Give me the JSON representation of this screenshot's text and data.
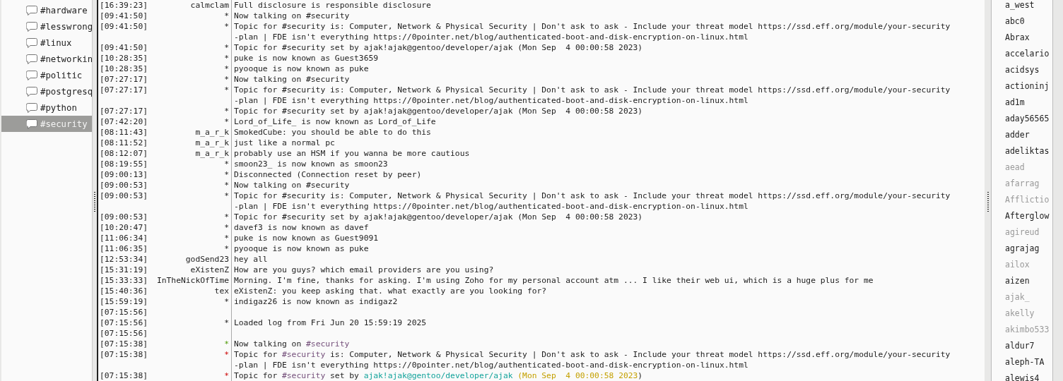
{
  "channels": [
    {
      "label": "#hardware",
      "selected": false
    },
    {
      "label": "#lesswrong",
      "selected": false
    },
    {
      "label": "#linux",
      "selected": false
    },
    {
      "label": "#networkin",
      "selected": false
    },
    {
      "label": "#politic",
      "selected": false
    },
    {
      "label": "#postgresq",
      "selected": false
    },
    {
      "label": "#python",
      "selected": false
    },
    {
      "label": "#security",
      "selected": true
    }
  ],
  "log": [
    {
      "time": "[16:39:23]",
      "nick": "calmclam",
      "text": "Full disclosure is responsible disclosure"
    },
    {
      "time": "[09:41:50]",
      "nick": "*",
      "text": "Now talking on #security"
    },
    {
      "time": "[09:41:50]",
      "nick": "*",
      "lines": [
        "Topic for #security is: Computer, Network & Physical Security | Don't ask to ask - Include your threat model https://ssd.eff.org/module/your-security",
        "-plan | FDE isn't everything https://0pointer.net/blog/authenticated-boot-and-disk-encryption-on-linux.html"
      ]
    },
    {
      "time": "[09:41:50]",
      "nick": "*",
      "text": "Topic for #security set by ajak!ajak@gentoo/developer/ajak (Mon Sep  4 00:00:58 2023)"
    },
    {
      "time": "[10:28:35]",
      "nick": "*",
      "text": "puke is now known as Guest3659"
    },
    {
      "time": "[10:28:35]",
      "nick": "*",
      "text": "pyooque is now known as puke"
    },
    {
      "time": "[07:27:17]",
      "nick": "*",
      "text": "Now talking on #security"
    },
    {
      "time": "[07:27:17]",
      "nick": "*",
      "lines": [
        "Topic for #security is: Computer, Network & Physical Security | Don't ask to ask - Include your threat model https://ssd.eff.org/module/your-security",
        "-plan | FDE isn't everything https://0pointer.net/blog/authenticated-boot-and-disk-encryption-on-linux.html"
      ]
    },
    {
      "time": "[07:27:17]",
      "nick": "*",
      "text": "Topic for #security set by ajak!ajak@gentoo/developer/ajak (Mon Sep  4 00:00:58 2023)"
    },
    {
      "time": "[07:42:20]",
      "nick": "*",
      "text": "Lord_of_Life_ is now known as Lord_of_Life"
    },
    {
      "time": "[08:11:43]",
      "nick": "m_a_r_k",
      "text": "SmokedCube: you should be able to do this"
    },
    {
      "time": "[08:11:52]",
      "nick": "m_a_r_k",
      "text": "just like a normal pc"
    },
    {
      "time": "[08:12:07]",
      "nick": "m_a_r_k",
      "text": "probably use an HSM if you wanna be more cautious"
    },
    {
      "time": "[08:19:55]",
      "nick": "*",
      "text": "smoon23_ is now known as smoon23"
    },
    {
      "time": "[09:00:13]",
      "nick": "*",
      "text": "Disconnected (Connection reset by peer)"
    },
    {
      "time": "[09:00:53]",
      "nick": "*",
      "text": "Now talking on #security"
    },
    {
      "time": "[09:00:53]",
      "nick": "*",
      "lines": [
        "Topic for #security is: Computer, Network & Physical Security | Don't ask to ask - Include your threat model https://ssd.eff.org/module/your-security",
        "-plan | FDE isn't everything https://0pointer.net/blog/authenticated-boot-and-disk-encryption-on-linux.html"
      ]
    },
    {
      "time": "[09:00:53]",
      "nick": "*",
      "text": "Topic for #security set by ajak!ajak@gentoo/developer/ajak (Mon Sep  4 00:00:58 2023)"
    },
    {
      "time": "[10:20:47]",
      "nick": "*",
      "text": "davef3 is now known as davef"
    },
    {
      "time": "[11:06:34]",
      "nick": "*",
      "text": "puke is now known as Guest9091"
    },
    {
      "time": "[11:06:35]",
      "nick": "*",
      "text": "pyooque is now known as puke"
    },
    {
      "time": "[12:53:34]",
      "nick": "godSend23",
      "text": "hey all"
    },
    {
      "time": "[15:31:19]",
      "nick": "eXistenZ",
      "text": "How are you guys? which email providers are you using?"
    },
    {
      "time": "[15:33:33]",
      "nick": "InTheNickOfTime",
      "text": "Morning. I'm fine, thanks for asking. I'm using Zoho for my personal account atm ... I like their web ui, which is a huge plus for me"
    },
    {
      "time": "[15:40:36]",
      "nick": "tex",
      "text": "eXistenZ: you keep asking that. what exactly are you looking for?"
    },
    {
      "time": "[15:59:19]",
      "nick": "*",
      "text": "indigaz26 is now known as indigaz2"
    },
    {
      "time": "[07:15:56]"
    },
    {
      "time": "[07:15:56]",
      "nick": "*",
      "text": "Loaded log from Fri Jun 20 15:59:19 2025"
    },
    {
      "time": "[07:15:56]"
    },
    {
      "time": "[07:15:38]",
      "nick": {
        "text": "*",
        "kind": "join"
      },
      "segments": [
        [
          {
            "text": "Now talking on ",
            "kind": "plain"
          },
          {
            "text": "#security",
            "kind": "channel"
          }
        ]
      ]
    },
    {
      "time": "[07:15:38]",
      "nick": {
        "text": "*",
        "kind": "topic"
      },
      "segments": [
        [
          {
            "text": "Topic for ",
            "kind": "plain"
          },
          {
            "text": "#security",
            "kind": "channel"
          },
          {
            "text": " is: Computer, Network & Physical Security | Don't ask to ask - Include your threat model https://ssd.eff.org/module/your-security",
            "kind": "plain"
          }
        ],
        [
          {
            "text": "-plan | FDE isn't everything https://0pointer.net/blog/authenticated-boot-and-disk-encryption-on-linux.html",
            "kind": "plain"
          }
        ]
      ]
    },
    {
      "time": "[07:15:38]",
      "nick": {
        "text": "*",
        "kind": "topic"
      },
      "segments": [
        [
          {
            "text": "Topic for ",
            "kind": "plain"
          },
          {
            "text": "#security",
            "kind": "channel"
          },
          {
            "text": " set by ",
            "kind": "plain"
          },
          {
            "text": "ajak!ajak@gentoo/developer/ajak",
            "kind": "host"
          },
          {
            "text": " (Mon Sep  4 00:00:58 2023",
            "kind": "date"
          },
          {
            "text": ")",
            "kind": "plain"
          }
        ]
      ]
    }
  ],
  "users": [
    {
      "name": "a_west",
      "away": false
    },
    {
      "name": "abc0",
      "away": false
    },
    {
      "name": "Abrax",
      "away": false
    },
    {
      "name": "accelario",
      "away": false
    },
    {
      "name": "acidsys",
      "away": false
    },
    {
      "name": "actioninj",
      "away": false
    },
    {
      "name": "ad1m",
      "away": false
    },
    {
      "name": "aday56565",
      "away": false
    },
    {
      "name": "adder",
      "away": false
    },
    {
      "name": "adeliktas",
      "away": false
    },
    {
      "name": "aead",
      "away": true
    },
    {
      "name": "afarrag",
      "away": true
    },
    {
      "name": "Afflictio",
      "away": true
    },
    {
      "name": "Afterglow",
      "away": false
    },
    {
      "name": "agireud",
      "away": true
    },
    {
      "name": "agrajag",
      "away": false
    },
    {
      "name": "ailox",
      "away": true
    },
    {
      "name": "aizen",
      "away": false
    },
    {
      "name": "ajak_",
      "away": true
    },
    {
      "name": "akelly",
      "away": true
    },
    {
      "name": "akimbo533",
      "away": true
    },
    {
      "name": "aldur7",
      "away": false
    },
    {
      "name": "aleph-TA",
      "away": false
    },
    {
      "name": "alewis4",
      "away": false
    }
  ]
}
